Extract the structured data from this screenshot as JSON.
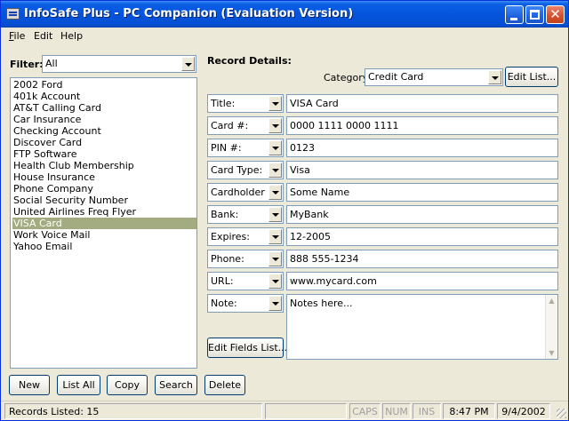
{
  "window": {
    "title": "InfoSafe Plus - PC Companion (Evaluation Version)",
    "app_icon": "app-icon",
    "controls": [
      "minimize-icon",
      "maximize-icon",
      "close-icon"
    ],
    "close_glyph": "✕"
  },
  "menu": {
    "file_u": "F",
    "file_rest": "ile",
    "edit": "Edit",
    "help": "Help"
  },
  "filter": {
    "label": "Filter:",
    "value": "All"
  },
  "records": {
    "items": [
      "2002 Ford",
      "401k Account",
      "AT&T Calling Card",
      "Car Insurance",
      "Checking Account",
      "Discover Card",
      "FTP Software",
      "Health Club Membership",
      "House Insurance",
      "Phone Company",
      "Social Security Number",
      "United Airlines Freq Flyer",
      "VISA Card",
      "Work Voice Mail",
      "Yahoo Email"
    ],
    "selected": "VISA Card"
  },
  "buttons": {
    "new": "New",
    "list_all": "List All",
    "copy": "Copy",
    "search": "Search",
    "delete": "Delete",
    "edit_list": "Edit List...",
    "edit_fields": "Edit Fields List..."
  },
  "details": {
    "heading": "Record Details:",
    "category_label": "Category:",
    "category_value": "Credit Card",
    "fields": [
      {
        "label": "Title:",
        "value": "VISA Card"
      },
      {
        "label": "Card #:",
        "value": "0000 1111 0000 1111"
      },
      {
        "label": "PIN #:",
        "value": "0123"
      },
      {
        "label": "Card Type:",
        "value": "Visa"
      },
      {
        "label": "Cardholder",
        "value": "Some Name"
      },
      {
        "label": "Bank:",
        "value": "MyBank"
      },
      {
        "label": "Expires:",
        "value": "12-2005"
      },
      {
        "label": "Phone:",
        "value": "888 555-1234"
      },
      {
        "label": "URL:",
        "value": "www.mycard.com"
      }
    ],
    "note_label": "Note:",
    "note_value": "Notes here..."
  },
  "status": {
    "records_listed": "Records Listed: 15",
    "caps": "CAPS",
    "num": "NUM",
    "ins": "INS",
    "time": "8:47 PM",
    "date": "9/4/2002"
  },
  "colors": {
    "title_bar": "#0553dd",
    "window_bg": "#ece9d8",
    "selection": "#a3ab80"
  }
}
